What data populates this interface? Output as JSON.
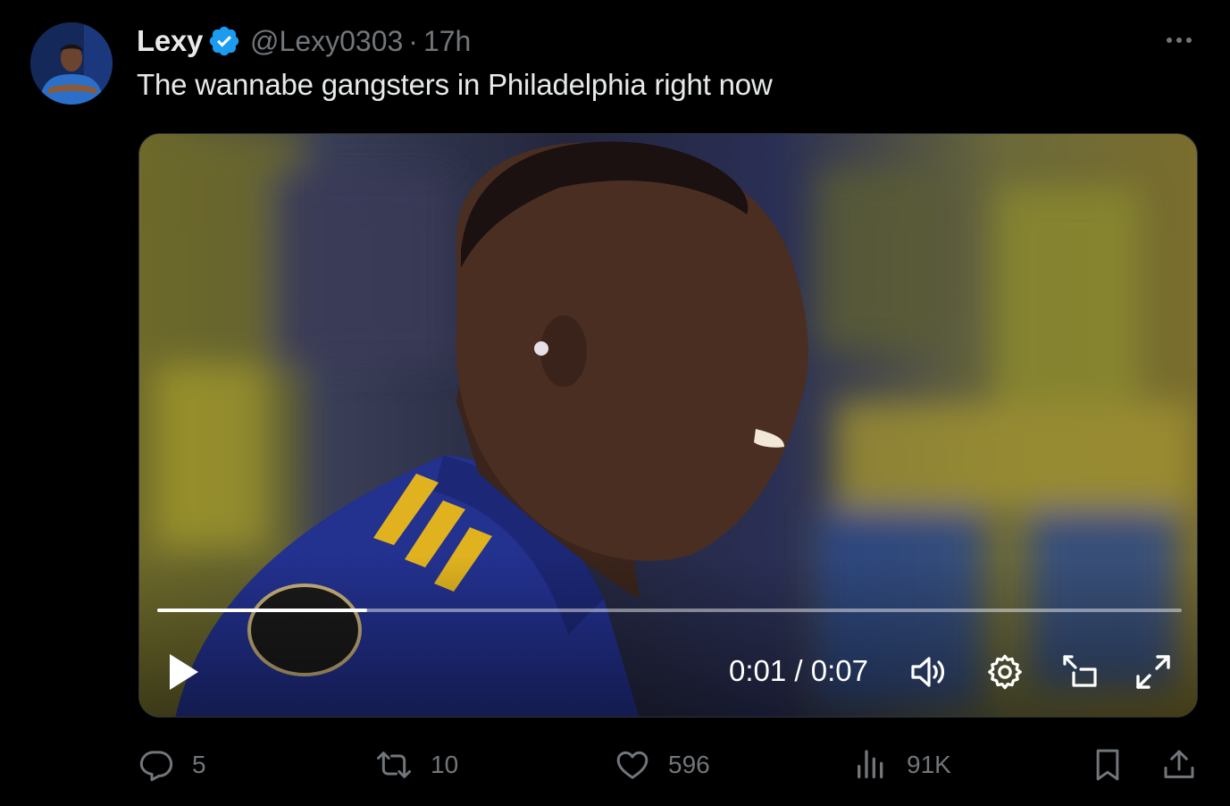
{
  "author": {
    "display_name": "Lexy",
    "handle": "@Lexy0303",
    "separator": "·",
    "time": "17h",
    "verified": true,
    "avatar_icon": "avatar"
  },
  "tweet": {
    "text": "The wannabe gangsters in Philadelphia right now"
  },
  "video": {
    "progress": 0.205,
    "current_time": "0:01",
    "duration": "0:07",
    "time_display": "0:01 / 0:07",
    "icons": [
      "play-icon",
      "volume-icon",
      "settings-gear-icon",
      "picture-in-picture-icon",
      "fullscreen-icon"
    ]
  },
  "actions": {
    "replies": "5",
    "reposts": "10",
    "likes": "596",
    "views": "91K"
  },
  "colors": {
    "background": "#000000",
    "text_primary": "#e7e9ea",
    "text_secondary": "#71767b",
    "verified_blue": "#1d9bf0"
  }
}
